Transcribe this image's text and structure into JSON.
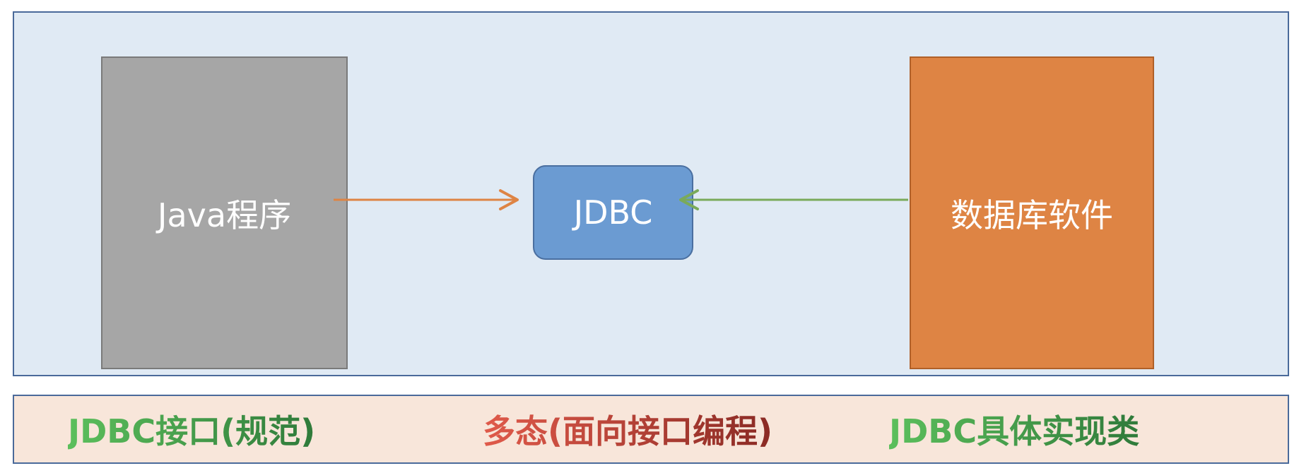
{
  "diagram": {
    "nodes": {
      "java_program": "Java程序",
      "jdbc": "JDBC",
      "database_software": "数据库软件"
    },
    "edges": [
      {
        "from": "java_program",
        "to": "jdbc",
        "color": "#de8444"
      },
      {
        "from": "database_software",
        "to": "jdbc",
        "color": "#7aaa5a"
      }
    ]
  },
  "captions": {
    "left": "JDBC接口(规范)",
    "middle": "多态(面向接口编程)",
    "right": "JDBC具体实现类"
  },
  "colors": {
    "panel_background": "#e0eaf4",
    "panel_border": "#4a6a9a",
    "java_box": "#a6a6a6",
    "jdbc_box": "#6b9bd2",
    "db_box": "#de8444",
    "caption_panel": "#f8e6da",
    "caption_green": "#4aa84e",
    "caption_red": "#c0392b"
  }
}
